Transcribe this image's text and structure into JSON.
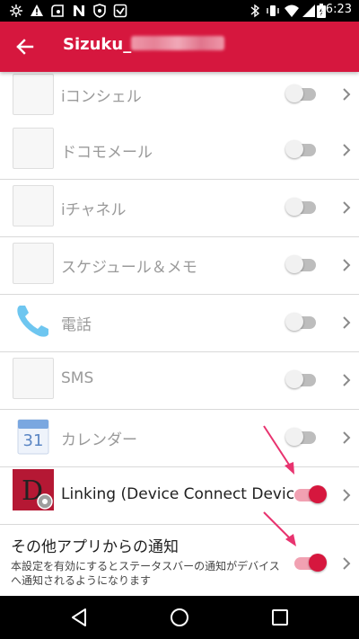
{
  "status_bar": {
    "time": "16:23",
    "left_icons": [
      "settings-icon",
      "warning-icon",
      "accessibility-icon",
      "n-notification-icon",
      "shield-icon",
      "download-icon"
    ],
    "right_icons": [
      "bluetooth-icon",
      "vibrate-icon",
      "wifi-icon",
      "signal-icon",
      "battery-icon"
    ]
  },
  "app_bar": {
    "title": "Sizuku_",
    "background": "#d6173e"
  },
  "list": {
    "items": [
      {
        "label": "iコンシェル",
        "icon": "placeholder-icon",
        "enabled": false
      },
      {
        "label": "ドコモメール",
        "icon": "placeholder-icon",
        "enabled": false
      },
      {
        "label": "iチャネル",
        "icon": "placeholder-icon",
        "enabled": false
      },
      {
        "label": "スケジュール＆メモ",
        "icon": "placeholder-icon",
        "enabled": false
      },
      {
        "label": "電話",
        "icon": "phone-icon",
        "enabled": false
      },
      {
        "label": "SMS",
        "icon": "placeholder-icon",
        "enabled": false
      },
      {
        "label": "カレンダー",
        "icon": "calendar-icon",
        "calendar_day": "31",
        "enabled": false
      },
      {
        "label": "Linking (Device Connect Devic...",
        "icon": "linking-app-icon",
        "enabled": true
      },
      {
        "label": "その他アプリからの通知",
        "description": "本設定を有効にするとステータスバーの通知がデバイスへ通知されるようになります",
        "enabled": true
      }
    ]
  },
  "colors": {
    "accent": "#d6173e",
    "toggle_on_track": "#f1a1b2",
    "annotation_arrow": "#e8336f"
  },
  "nav_bar": {
    "buttons": [
      "back-nav-icon",
      "home-nav-icon",
      "recents-nav-icon"
    ]
  }
}
